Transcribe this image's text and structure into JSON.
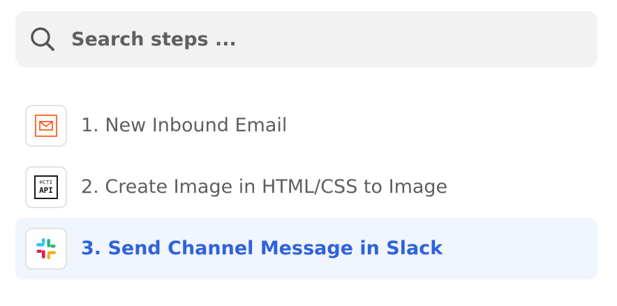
{
  "search": {
    "placeholder": "Search steps ...",
    "icon": "search-icon"
  },
  "steps": [
    {
      "label": "1. New Inbound Email",
      "icon": "email-icon",
      "active": false
    },
    {
      "label": "2. Create Image in HTML/CSS to Image",
      "icon": "hcti-api-icon",
      "icon_text": [
        "HCTI",
        "API"
      ],
      "active": false
    },
    {
      "label": "3. Send Channel Message in Slack",
      "icon": "slack-icon",
      "active": true
    }
  ],
  "colors": {
    "search_bg": "#f2f2f2",
    "text": "#5f5f5f",
    "active_text": "#2f63db",
    "active_bg": "#f1f5fe",
    "email_accent": "#ff4a00"
  }
}
